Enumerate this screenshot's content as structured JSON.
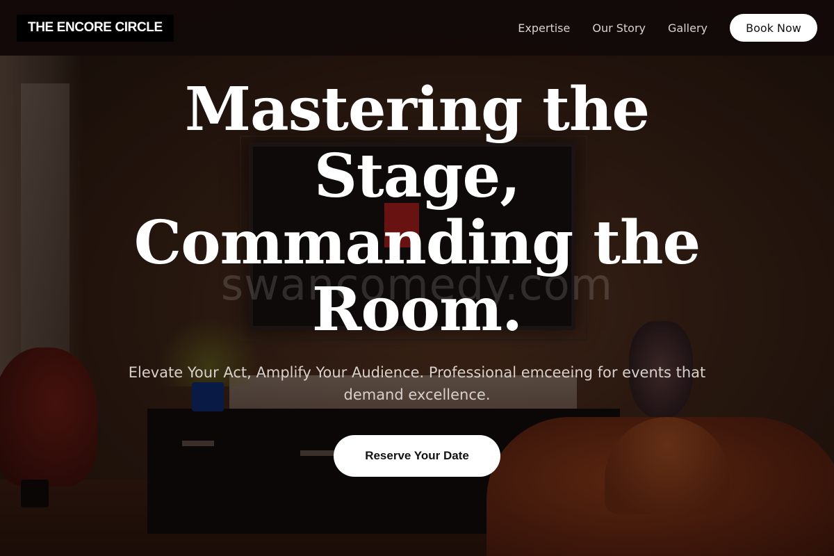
{
  "header": {
    "logo_text": "THE ENCORE CIRCLE",
    "nav": [
      {
        "label": "Expertise"
      },
      {
        "label": "Our Story"
      },
      {
        "label": "Gallery"
      }
    ],
    "cta_label": "Book Now"
  },
  "hero": {
    "title": "Mastering the Stage, Commanding the Room.",
    "subtitle": "Elevate Your Act, Amplify Your Audience. Professional emceeing for events that demand excellence.",
    "cta_label": "Reserve Your Date",
    "watermark": "swancomedy.com"
  },
  "colors": {
    "header_bg": "#120a08",
    "button_bg": "#ffffff",
    "button_text": "#111111",
    "title_text": "#ffffff",
    "subtitle_text": "#d8d0cb"
  }
}
